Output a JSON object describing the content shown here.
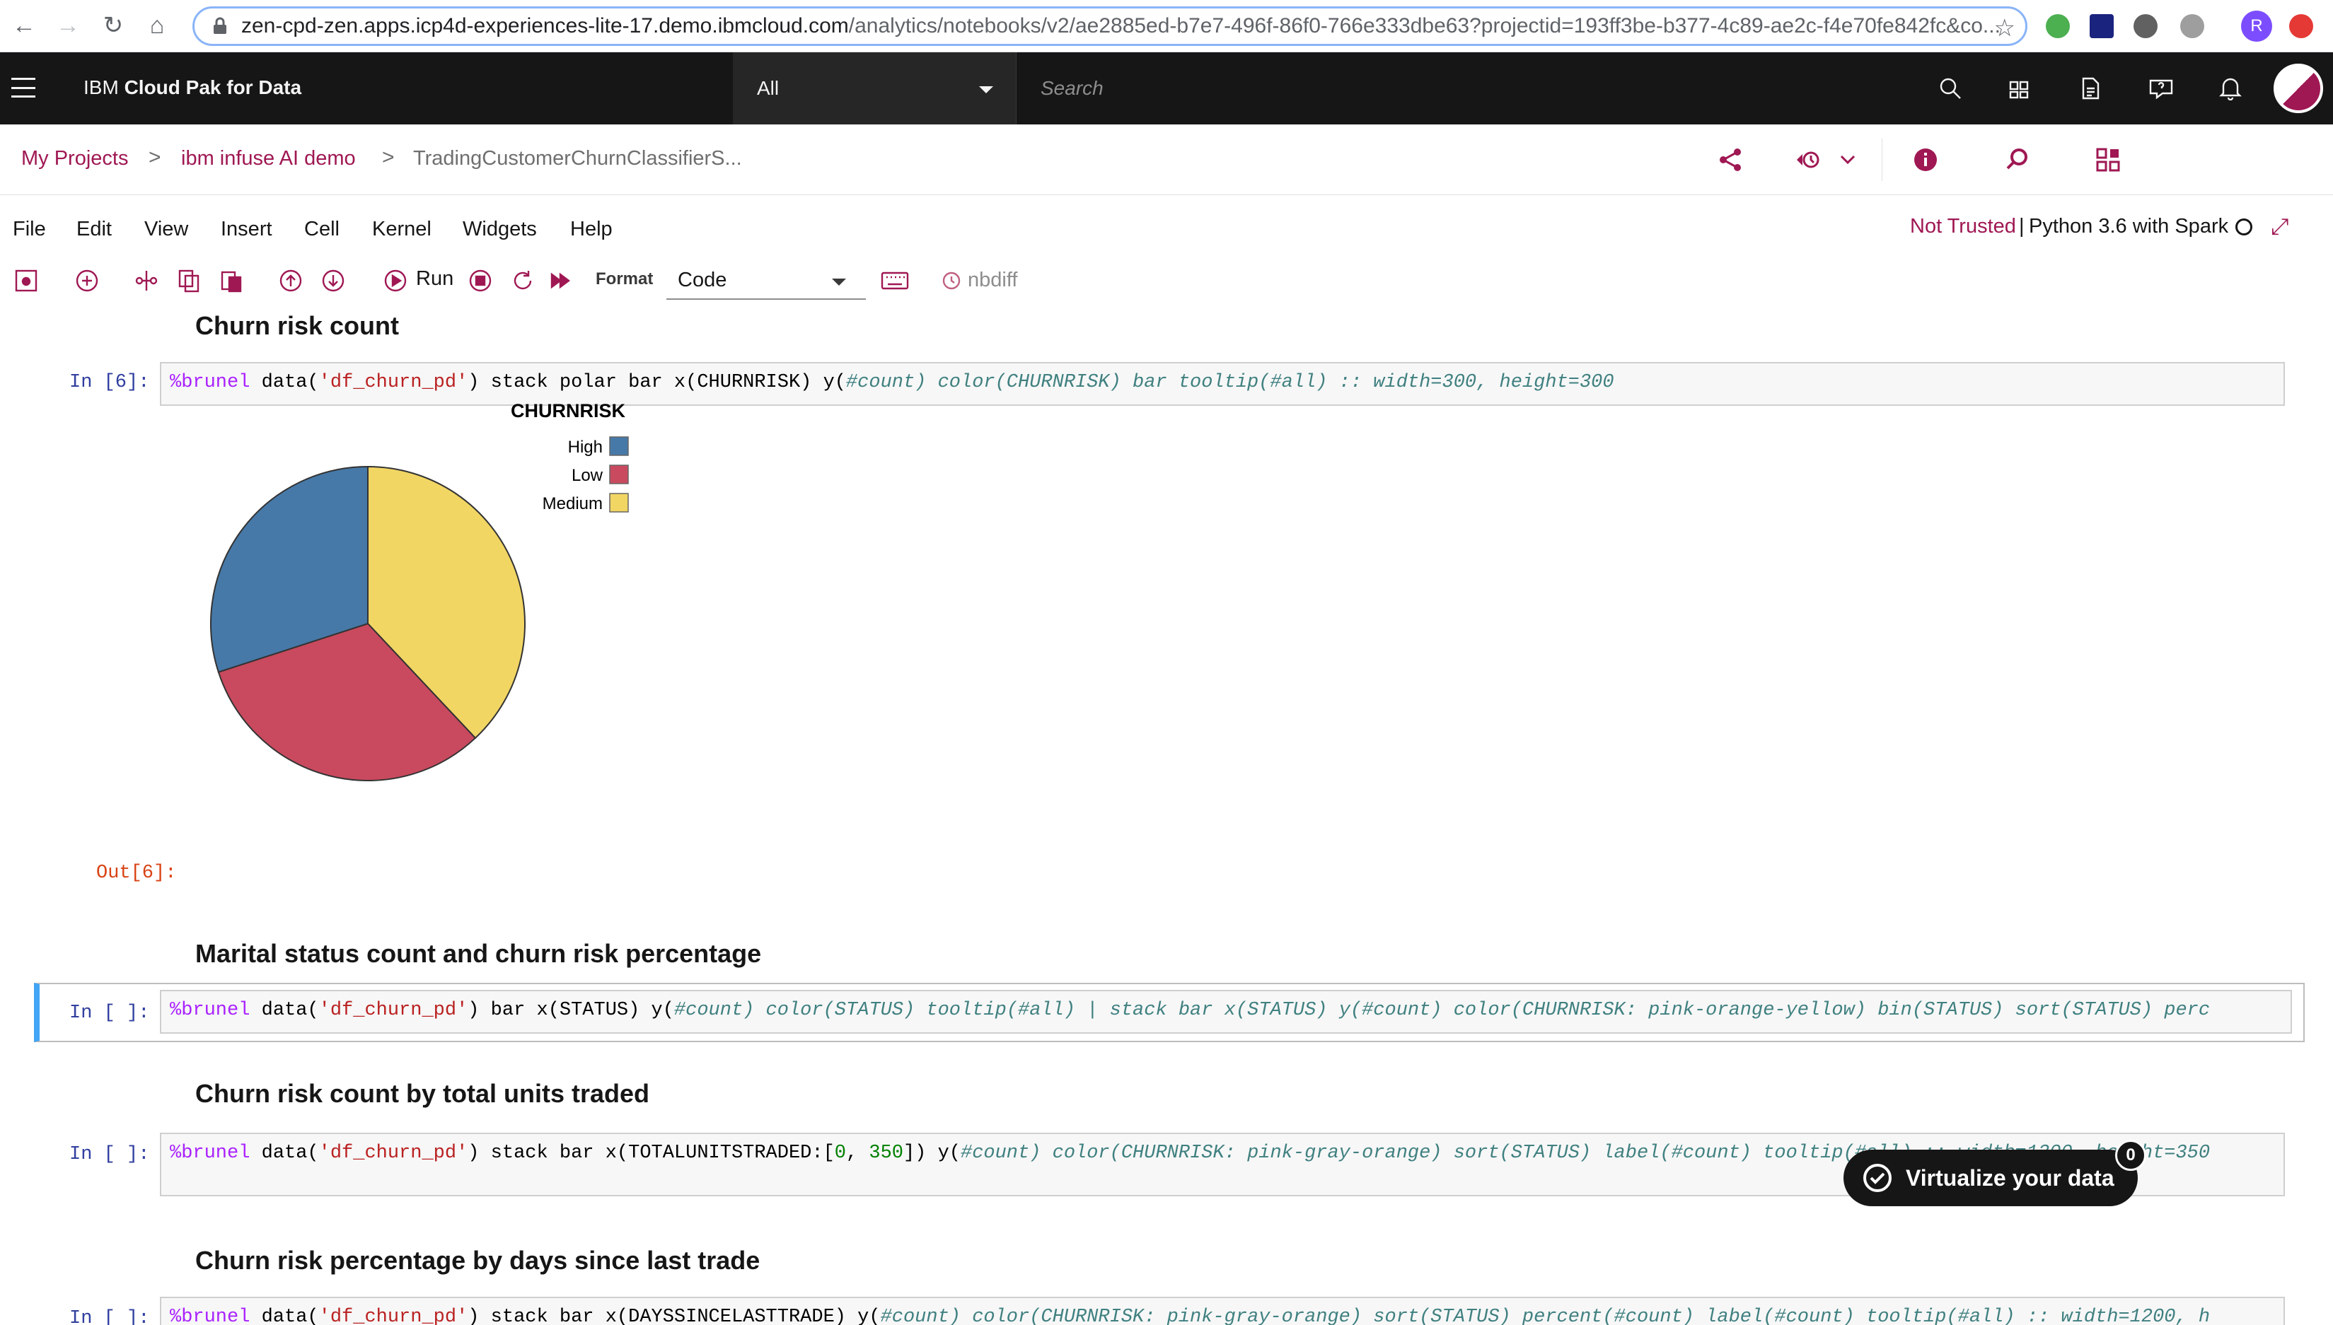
{
  "browser": {
    "url_host": "zen-cpd-zen.apps.icp4d-experiences-lite-17.demo.ibmcloud.com",
    "url_path": "/analytics/notebooks/v2/ae2885ed-b7e7-496f-86f0-766e333dbe63?projectid=193ff3be-b377-4c89-ae2c-f4e70fe842fc&co...",
    "profile_initial": "R"
  },
  "header": {
    "product_prefix": "IBM",
    "product_name": "Cloud Pak for Data",
    "scope": "All",
    "search_placeholder": "Search"
  },
  "breadcrumb": {
    "items": [
      "My Projects",
      "ibm infuse AI demo",
      "TradingCustomerChurnClassifierS..."
    ],
    "separator": ">"
  },
  "menu": {
    "items": [
      "File",
      "Edit",
      "View",
      "Insert",
      "Cell",
      "Kernel",
      "Widgets",
      "Help"
    ],
    "trusted": "Not Trusted",
    "kernel_sep": "|",
    "kernel": "Python 3.6 with Spark"
  },
  "toolbar": {
    "run_label": "Run",
    "format_label": "Format",
    "cell_type": "Code",
    "nbdiff_label": "nbdiff"
  },
  "cells": [
    {
      "heading": "Churn risk count",
      "prompt": "In [6]:",
      "code": {
        "magic": "%brunel",
        "p1": " data(",
        "s1": "'df_churn_pd'",
        "p2": ") stack polar bar x(CHURNRISK) y(",
        "c1": "#count) color(CHURNRISK) bar tooltip(#all) :: width=300, height=300"
      },
      "out_prompt": "Out[6]:"
    },
    {
      "heading": "Marital status count and churn risk percentage",
      "prompt": "In [ ]:",
      "code": {
        "magic": "%brunel",
        "p1": " data(",
        "s1": "'df_churn_pd'",
        "p2": ") bar x(STATUS) y(",
        "c1": "#count) color(STATUS) tooltip(#all) | stack bar x(STATUS) y(#count) color(CHURNRISK: pink-orange-yellow) bin(STATUS) sort(STATUS) perc"
      }
    },
    {
      "heading": "Churn risk count by total units traded",
      "prompt": "In [ ]:",
      "code": {
        "magic": "%brunel",
        "p1": " data(",
        "s1": "'df_churn_pd'",
        "p2": ") stack bar x(TOTALUNITSTRADED:[",
        "n1": "0",
        "p3": ", ",
        "n2": "350",
        "p4": "]) y(",
        "c1": "#count) color(CHURNRISK: pink-gray-orange) sort(STATUS) label(#count) tooltip(#all) :: width=1200, height=350"
      }
    },
    {
      "heading": "Churn risk percentage by days since last trade",
      "prompt": "In [ ]:",
      "code": {
        "magic": "%brunel",
        "p1": " data(",
        "s1": "'df_churn_pd'",
        "p2": ") stack bar x(DAYSSINCELASTTRADE) y(",
        "c1": "#count) color(CHURNRISK: pink-gray-orange) sort(STATUS) percent(#count) label(#count) tooltip(#all) :: width=1200, h"
      }
    }
  ],
  "chart_data": {
    "type": "pie",
    "title": "",
    "legend_title": "CHURNRISK",
    "legend_position": "top-right",
    "categories": [
      "High",
      "Low",
      "Medium"
    ],
    "values": [
      30,
      32,
      38
    ],
    "colors": [
      "#4679a8",
      "#c94a5e",
      "#f2d664"
    ]
  },
  "toast": {
    "label": "Virtualize your data",
    "badge": "0"
  }
}
